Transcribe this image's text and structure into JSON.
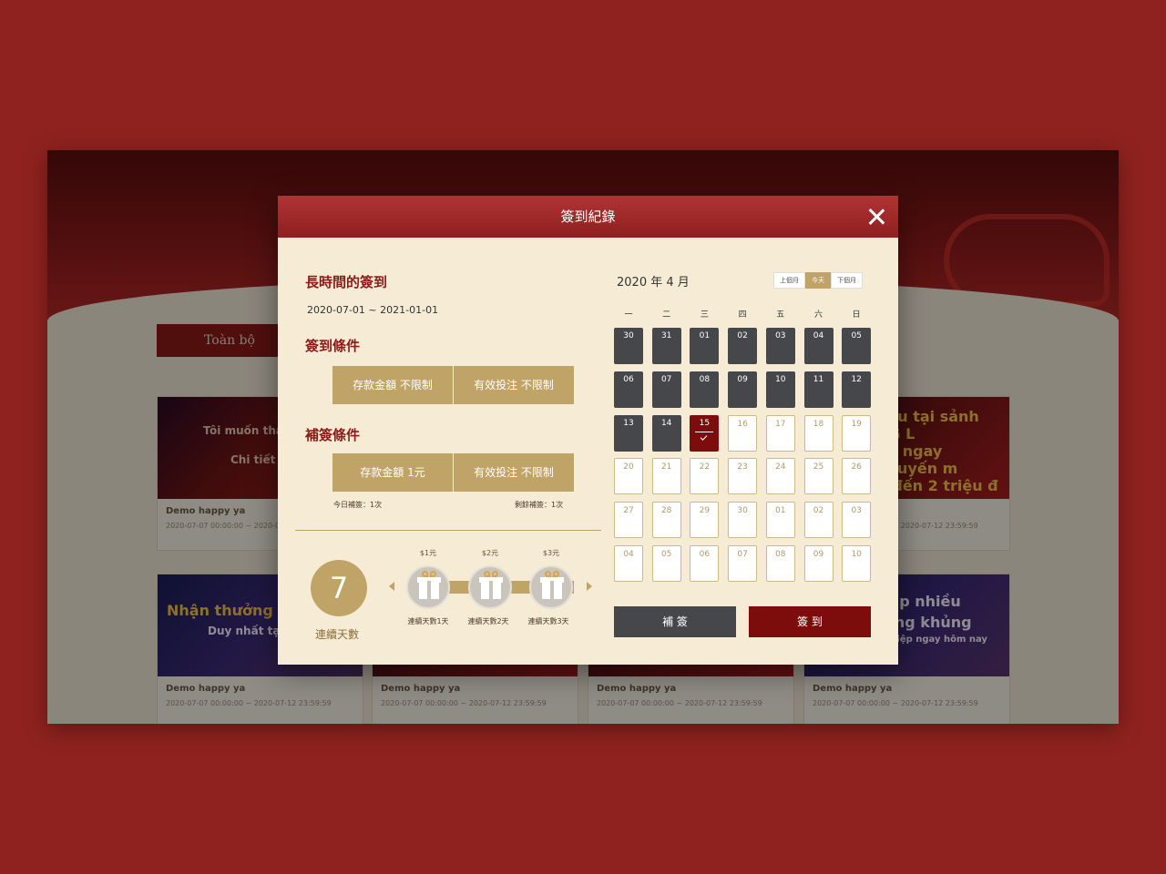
{
  "background": {
    "tab_all": "Toàn bộ",
    "card_title": "Demo happy ya",
    "card_date": "2020-07-07 00:00:00 ~ 2020-07-12 23:59:59",
    "banner_texts": [
      "Nhận thưởng",
      "Duy nhất tại",
      "đấu tại sảnh AG L",
      "ận ngay khuyến m",
      "a đến 2 triệu đ",
      "Nạp nhiều",
      "rởng khủng",
      "nghiệp ngay hôm nay"
    ],
    "button_texts": [
      "Tôi muốn tha",
      "Chi tiết"
    ]
  },
  "modal": {
    "title": "簽到紀錄",
    "section_long": "長時間的簽到",
    "date_range": "2020-07-01 ~ 2021-01-01",
    "section_condition": "簽到條件",
    "condition": [
      "存款金額 不限制",
      "有效投注 不限制"
    ],
    "section_makeup": "補簽條件",
    "makeup_condition": [
      "存款金額 1元",
      "有效投注 不限制"
    ],
    "today_makeup": "今日補簽：1次",
    "remaining_makeup": "剩餘補簽：1次",
    "consecutive_days": "7",
    "consecutive_label": "連續天數",
    "rewards": [
      {
        "price": "$1元",
        "label": "連續天數1天"
      },
      {
        "price": "$2元",
        "label": "連續天數2天"
      },
      {
        "price": "$3元",
        "label": "連續天數3天"
      }
    ],
    "calendar": {
      "title": "2020 年 4 月",
      "nav": [
        "上個月",
        "今天",
        "下個月"
      ],
      "weekdays": [
        "一",
        "二",
        "三",
        "四",
        "五",
        "六",
        "日"
      ],
      "weeks": [
        [
          "30",
          "31",
          "01",
          "02",
          "03",
          "04",
          "05"
        ],
        [
          "06",
          "07",
          "08",
          "09",
          "10",
          "11",
          "12"
        ],
        [
          "13",
          "14",
          "15",
          "16",
          "17",
          "18",
          "19"
        ],
        [
          "20",
          "21",
          "22",
          "23",
          "24",
          "25",
          "26"
        ],
        [
          "27",
          "28",
          "29",
          "30",
          "01",
          "02",
          "03"
        ],
        [
          "04",
          "05",
          "06",
          "07",
          "08",
          "09",
          "10"
        ]
      ],
      "signed_through_index": 16,
      "today": "16"
    },
    "makeup_button": "補 簽",
    "signin_button": "簽 到"
  }
}
